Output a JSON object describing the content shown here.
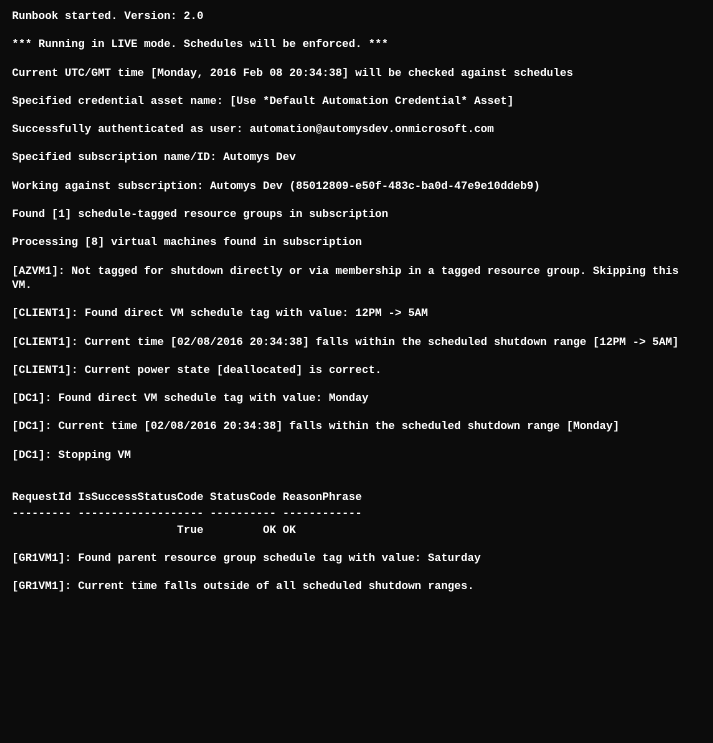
{
  "lines": {
    "l0": "Runbook started. Version: 2.0",
    "l1": "*** Running in LIVE mode. Schedules will be enforced. ***",
    "l2": "Current UTC/GMT time [Monday, 2016 Feb 08 20:34:38] will be checked against schedules",
    "l3": "Specified credential asset name: [Use *Default Automation Credential* Asset]",
    "l4": "Successfully authenticated as user: automation@automysdev.onmicrosoft.com",
    "l5": "Specified subscription name/ID: Automys Dev",
    "l6": "Working against subscription: Automys Dev (85012809-e50f-483c-ba0d-47e9e10ddeb9)",
    "l7": "Found [1] schedule-tagged resource groups in subscription",
    "l8": "Processing [8] virtual machines found in subscription",
    "l9": "[AZVM1]: Not tagged for shutdown directly or via membership in a tagged resource group. Skipping this VM.",
    "l10": "[CLIENT1]: Found direct VM schedule tag with value: 12PM -> 5AM",
    "l11": "[CLIENT1]: Current time [02/08/2016 20:34:38] falls within the scheduled shutdown range [12PM -> 5AM]",
    "l12": "[CLIENT1]: Current power state [deallocated] is correct.",
    "l13": "[DC1]: Found direct VM schedule tag with value: Monday",
    "l14": "[DC1]: Current time [02/08/2016 20:34:38] falls within the scheduled shutdown range [Monday]",
    "l15": "[DC1]: Stopping VM",
    "tableHeader": "RequestId IsSuccessStatusCode StatusCode ReasonPhrase",
    "tableDivider": "--------- ------------------- ---------- ------------",
    "tableRow": "                         True         OK OK          ",
    "l16": "[GR1VM1]: Found parent resource group schedule tag with value: Saturday",
    "l17": "[GR1VM1]: Current time falls outside of all scheduled shutdown ranges."
  }
}
